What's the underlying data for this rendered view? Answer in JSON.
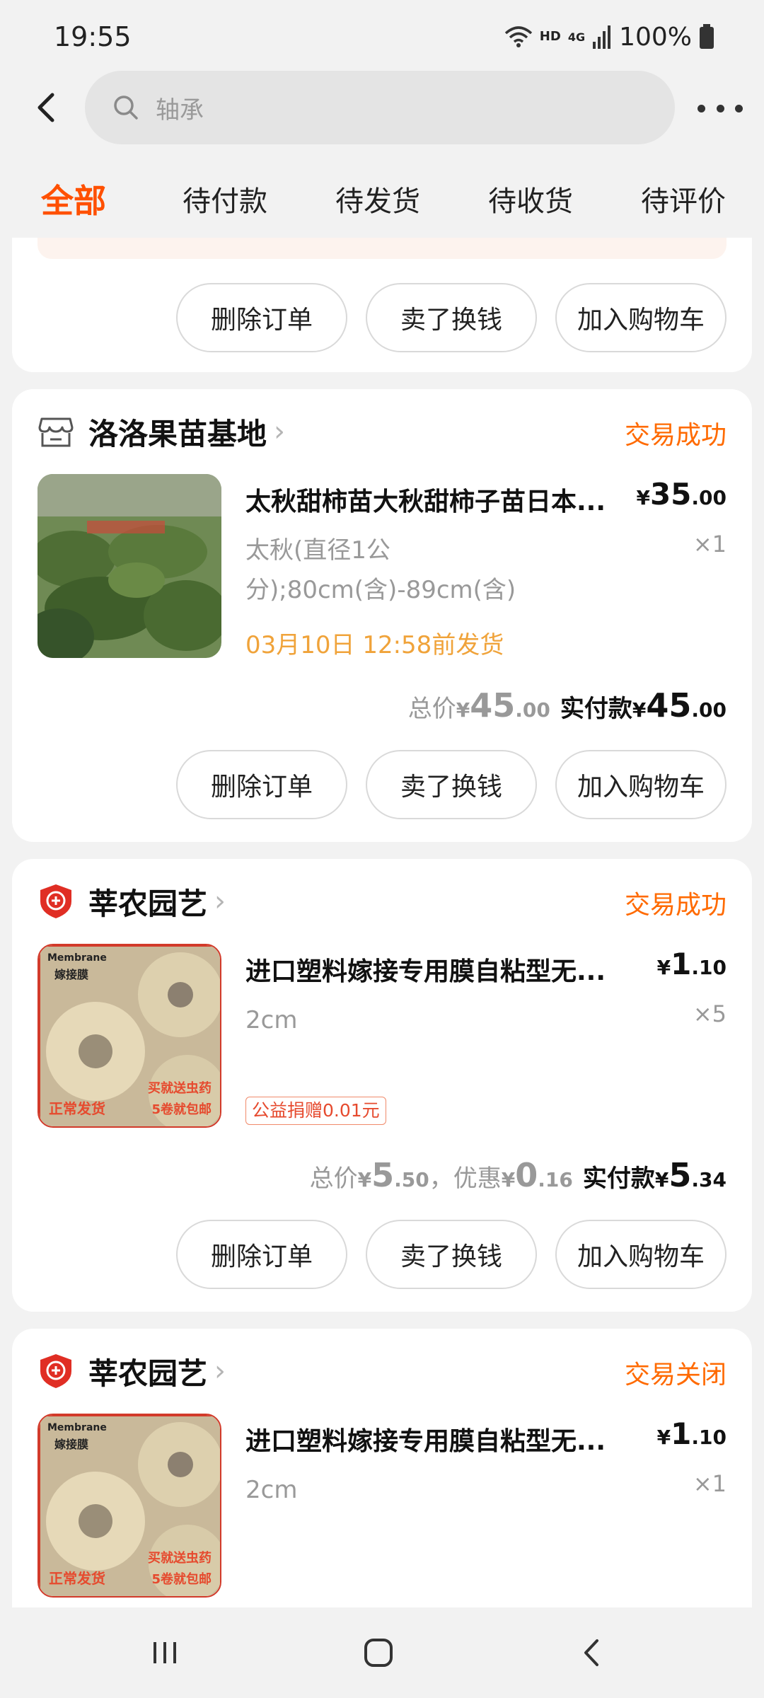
{
  "status_bar": {
    "time": "19:55",
    "hd": "HD",
    "network": "4G",
    "battery": "100%"
  },
  "search": {
    "placeholder": "轴承"
  },
  "tabs": [
    {
      "label": "全部",
      "active": true
    },
    {
      "label": "待付款"
    },
    {
      "label": "待发货"
    },
    {
      "label": "待收货"
    },
    {
      "label": "待评价"
    }
  ],
  "buttons": {
    "delete": "删除订单",
    "resell": "卖了换钱",
    "add_cart": "加入购物车"
  },
  "orders": [
    {
      "shop": "洛洛果苗基地",
      "shop_icon": "store-icon",
      "status": "交易成功",
      "title": "太秋甜柿苗大秋甜柿子苗日本...",
      "price": {
        "currency": "¥",
        "int": "35",
        "dec": ".00"
      },
      "spec": "太秋(直径1公分);80cm(含)-89cm(含)",
      "qty": "×1",
      "ship_note": "03月10日 12:58前发货",
      "total": {
        "label": "总价",
        "currency": "¥",
        "int": "45",
        "dec": ".00"
      },
      "paid": {
        "label": "实付款",
        "currency": "¥",
        "int": "45",
        "dec": ".00"
      }
    },
    {
      "shop": "莘农园艺",
      "shop_icon": "enterprise-shield-icon",
      "status": "交易成功",
      "title": "进口塑料嫁接专用膜自粘型无...",
      "price": {
        "currency": "¥",
        "int": "1",
        "dec": ".10"
      },
      "spec": "2cm",
      "qty": "×5",
      "tag": "公益捐赠0.01元",
      "total": {
        "label": "总价",
        "currency": "¥",
        "int": "5",
        "dec": ".50"
      },
      "discount": {
        "label": "，优惠",
        "currency": "¥",
        "int": "0",
        "dec": ".16"
      },
      "paid": {
        "label": "实付款",
        "currency": "¥",
        "int": "5",
        "dec": ".34"
      },
      "image_text": {
        "brand": "Membrane",
        "name": "嫁接膜",
        "left": "正常发货",
        "right1": "买就送虫药",
        "right2": "5卷就包邮"
      }
    },
    {
      "shop": "莘农园艺",
      "shop_icon": "enterprise-shield-icon",
      "status": "交易关闭",
      "title": "进口塑料嫁接专用膜自粘型无...",
      "price": {
        "currency": "¥",
        "int": "1",
        "dec": ".10"
      },
      "spec": "2cm",
      "qty": "×1"
    }
  ],
  "colors": {
    "accent": "#ff5000",
    "status": "#ff6a00",
    "ship": "#f0a33a"
  }
}
